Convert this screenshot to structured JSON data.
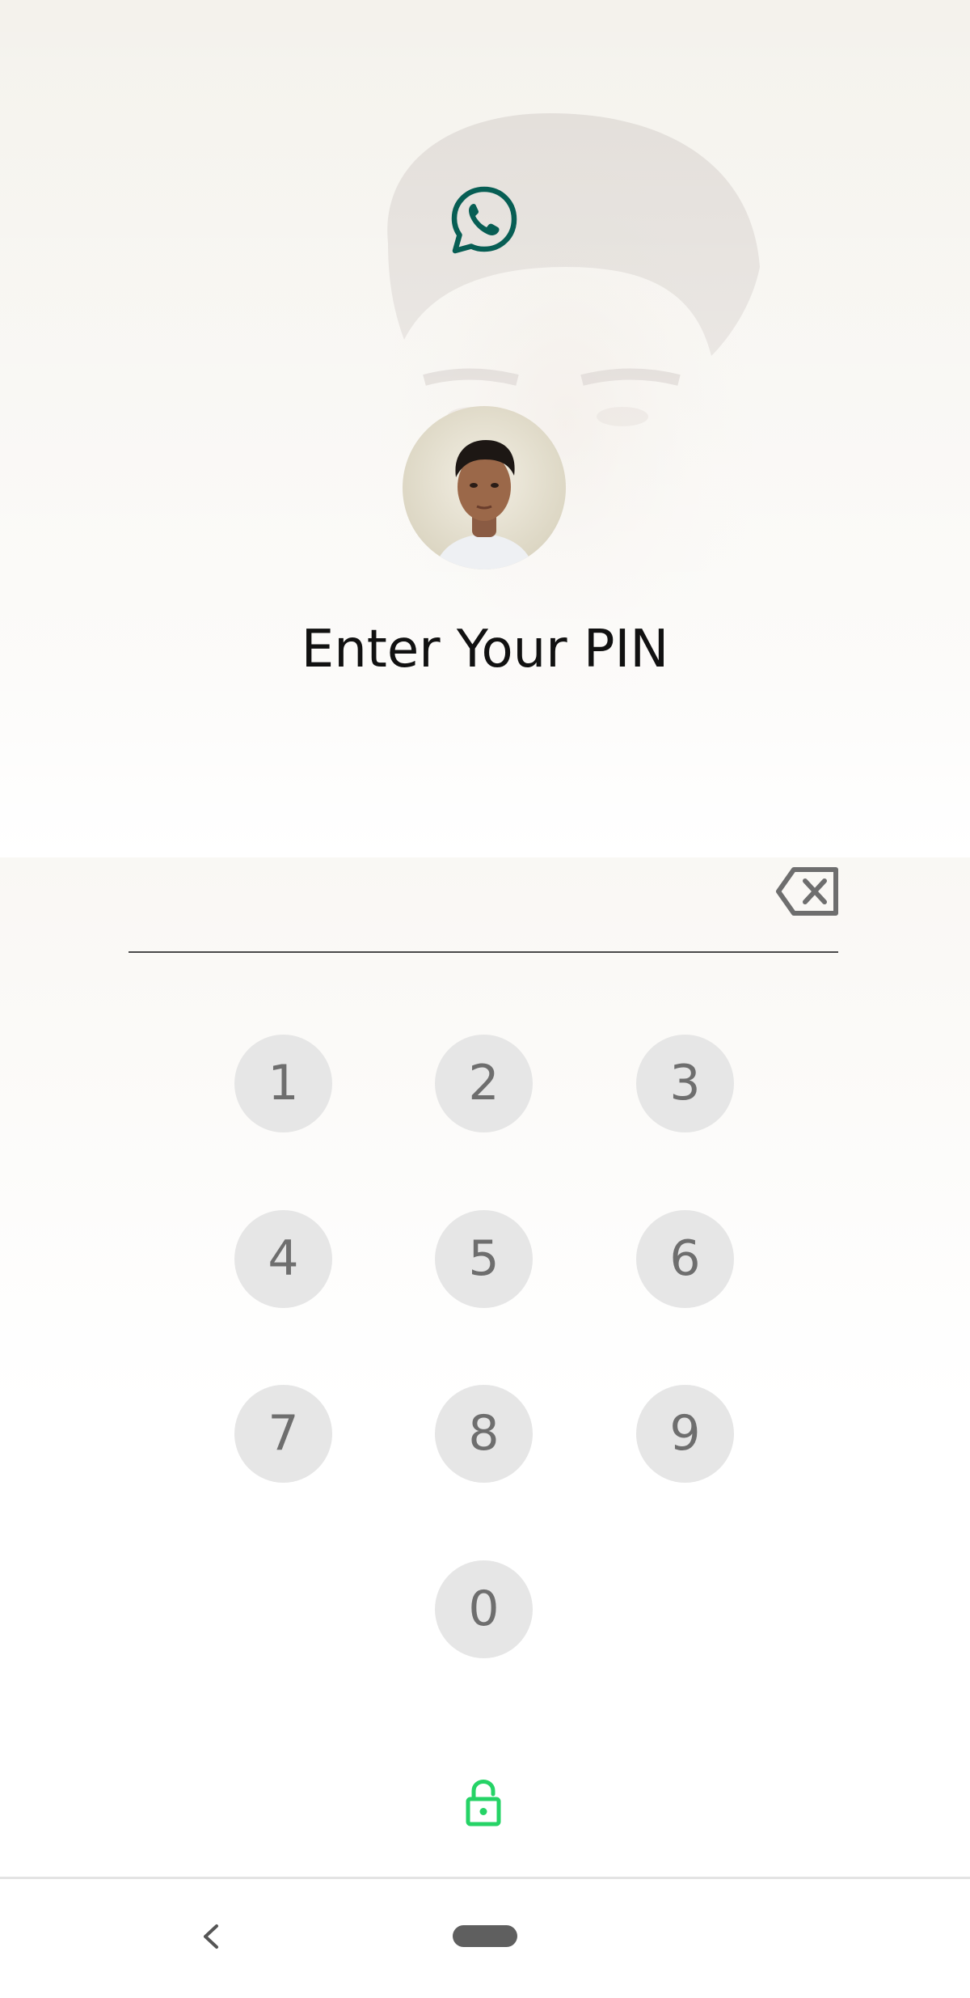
{
  "header": {
    "title": "Enter Your PIN"
  },
  "pin_input": {
    "value": ""
  },
  "keypad": {
    "keys": [
      "1",
      "2",
      "3",
      "4",
      "5",
      "6",
      "7",
      "8",
      "9",
      "0"
    ]
  },
  "icons": {
    "app_logo": "whatsapp-icon",
    "backspace": "backspace-icon",
    "lock": "lock-open-icon",
    "nav_back": "chevron-left-icon",
    "nav_home": "home-pill"
  },
  "colors": {
    "brand": "#075e54",
    "lock_green": "#25d366",
    "key_bg": "#e6e6e6",
    "key_text": "#6e6e6e"
  }
}
